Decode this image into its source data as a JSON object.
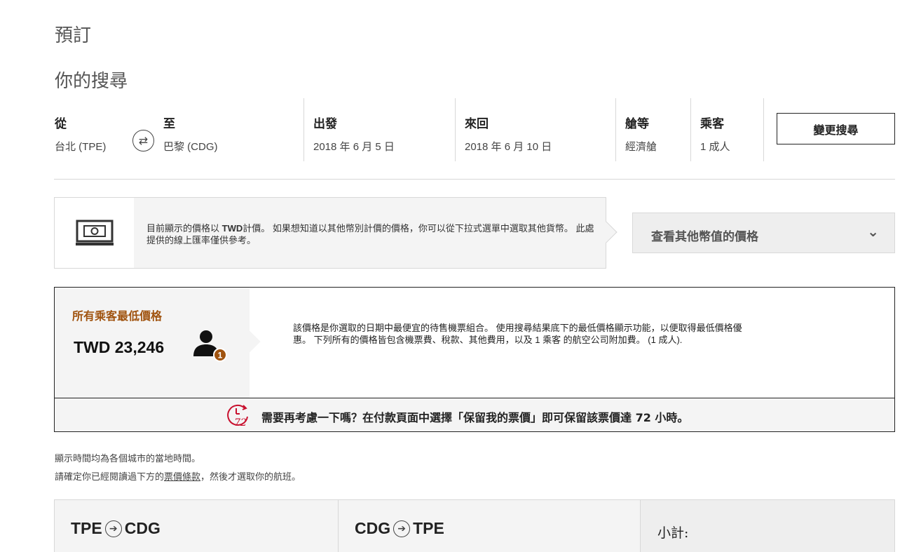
{
  "page": {
    "title": "預訂",
    "subtitle": "你的搜尋"
  },
  "search": {
    "from_label": "從",
    "from_value": "台北 (TPE)",
    "to_label": "至",
    "to_value": "巴黎 (CDG)",
    "depart_label": "出發",
    "depart_value": "2018 年 6 月 5 日",
    "return_label": "來回",
    "return_value": "2018 年 6 月 10 日",
    "class_label": "艙等",
    "class_value": "經濟艙",
    "pax_label": "乘客",
    "pax_value": "1 成人",
    "change_button": "變更搜尋",
    "swap_icon": "swap-arrows-icon"
  },
  "currency": {
    "text_before": "目前顯示的價格以 ",
    "code": "TWD",
    "text_after": "計價。 如果想知道以其他幣別計價的價格，你可以從下拉式選單中選取其他貨幣。 此處提供的線上匯率僅供參考。",
    "select_label": "查看其他幣值的價格",
    "icon": "money-laptop-icon"
  },
  "lowest": {
    "title": "所有乘客最低價格",
    "price": "TWD 23,246",
    "passenger_count": "1",
    "description": "該價格是你選取的日期中最便宜的待售機票組合。 使用搜尋結果底下的最低價格顯示功能，以便取得最低價格優惠。 下列所有的價格皆包含機票費、稅款、其他費用，以及 1 乘客 的航空公司附加費。 (1 成人).",
    "hold_text_before": "需要再考慮一下嗎？在付款頁面中選擇「保留我的票價」即可保留該票價達 ",
    "hold_hours": "72",
    "hold_text_after": " 小時。",
    "clock_number": "72",
    "accent_color": "#a0530f",
    "clock_color": "#c8102e"
  },
  "notes": {
    "line1": "顯示時間均為各個城市的當地時間。",
    "line2_before": "請確定你已經閱讀過下方的",
    "line2_link": "票價條款",
    "line2_after": "，然後才選取你的航班。"
  },
  "flights": {
    "outbound_from": "TPE",
    "outbound_to": "CDG",
    "inbound_from": "CDG",
    "inbound_to": "TPE",
    "subtotal_label": "小計:"
  }
}
